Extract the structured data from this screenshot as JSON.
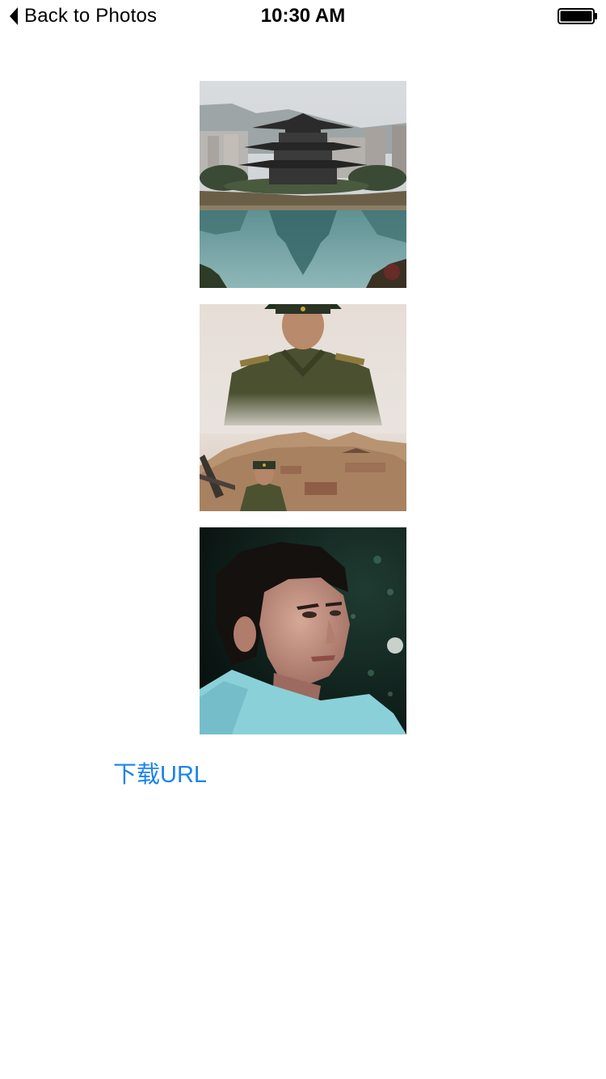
{
  "status_bar": {
    "back_label": "Back to Photos",
    "time": "10:30 AM",
    "battery_icon": "battery-full-icon"
  },
  "photos": [
    {
      "name": "pagoda-lake-photo",
      "subject": "pagoda-by-lake"
    },
    {
      "name": "soldier-collage-photo",
      "subject": "soldier-portrait-collage"
    },
    {
      "name": "young-man-portrait-photo",
      "subject": "young-man-portrait"
    }
  ],
  "actions": {
    "download_url_label": "下载URL"
  },
  "colors": {
    "link": "#1a82f0",
    "background": "#ffffff",
    "text": "#000000"
  }
}
